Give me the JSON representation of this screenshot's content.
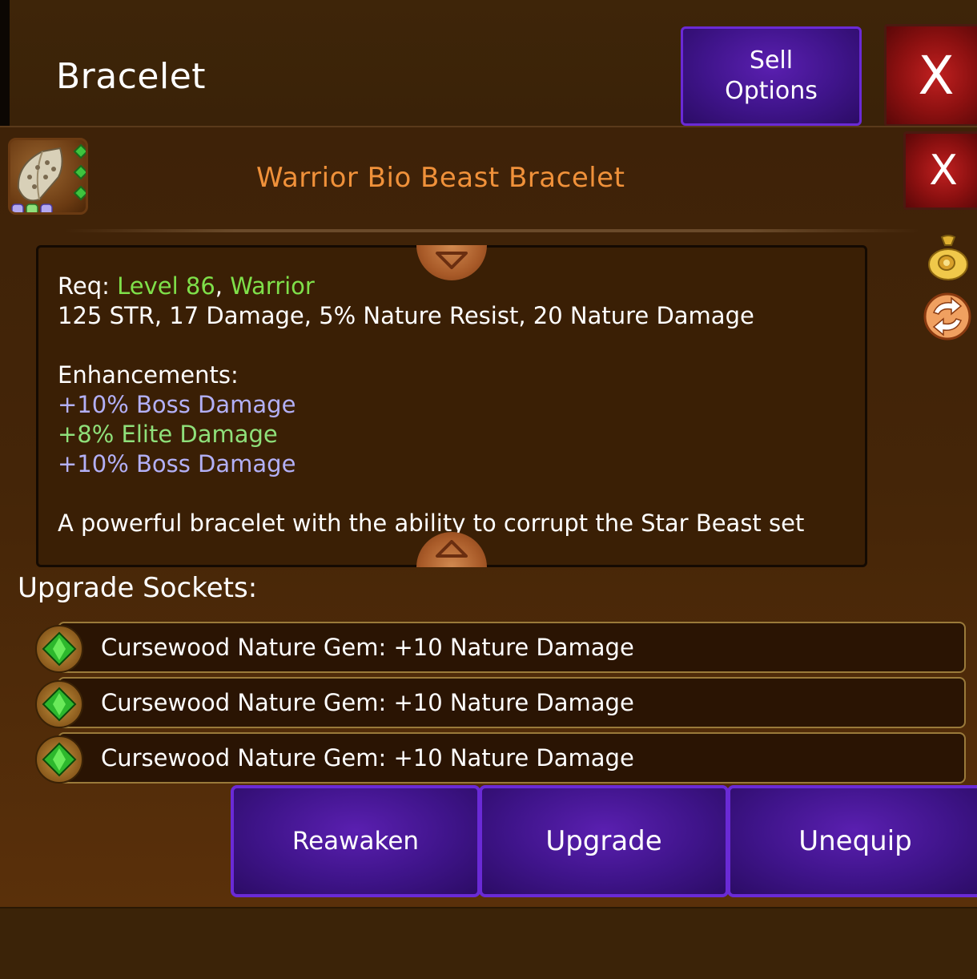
{
  "header": {
    "title": "Bracelet",
    "sell_options_label": "Sell\nOptions",
    "close_label": "X"
  },
  "item": {
    "name": "Warrior Bio Beast Bracelet",
    "close_label": "X",
    "icon": "bracelet-icon",
    "socket_dots": [
      "#b3a8f0",
      "#8fe07a",
      "#b3a8f0"
    ]
  },
  "description": {
    "req_prefix": "Req: ",
    "req_level": "Level 86",
    "req_sep": ", ",
    "req_class": "Warrior",
    "stats": "125 STR, 17 Damage, 5% Nature Resist, 20 Nature Damage",
    "enhancements_label": "Enhancements:",
    "enhancements": [
      "+10% Boss Damage",
      "+8% Elite Damage",
      "+10% Boss Damage"
    ],
    "flavor": "A powerful bracelet with the ability to corrupt the Star Beast set"
  },
  "side_icons": [
    "gold-bag-icon",
    "swap-icon"
  ],
  "sockets": {
    "label": "Upgrade Sockets:",
    "items": [
      "Cursewood Nature Gem: +10 Nature Damage",
      "Cursewood Nature Gem: +10 Nature Damage",
      "Cursewood Nature Gem: +10 Nature Damage"
    ]
  },
  "actions": {
    "reawaken": "Reawaken",
    "upgrade": "Upgrade",
    "unequip": "Unequip"
  },
  "colors": {
    "accent_orange": "#f0913a",
    "button_purple": "#3f148a",
    "close_red": "#8b1010",
    "req_green": "#7fe04a",
    "enh_lavender": "#b3b0f7"
  }
}
